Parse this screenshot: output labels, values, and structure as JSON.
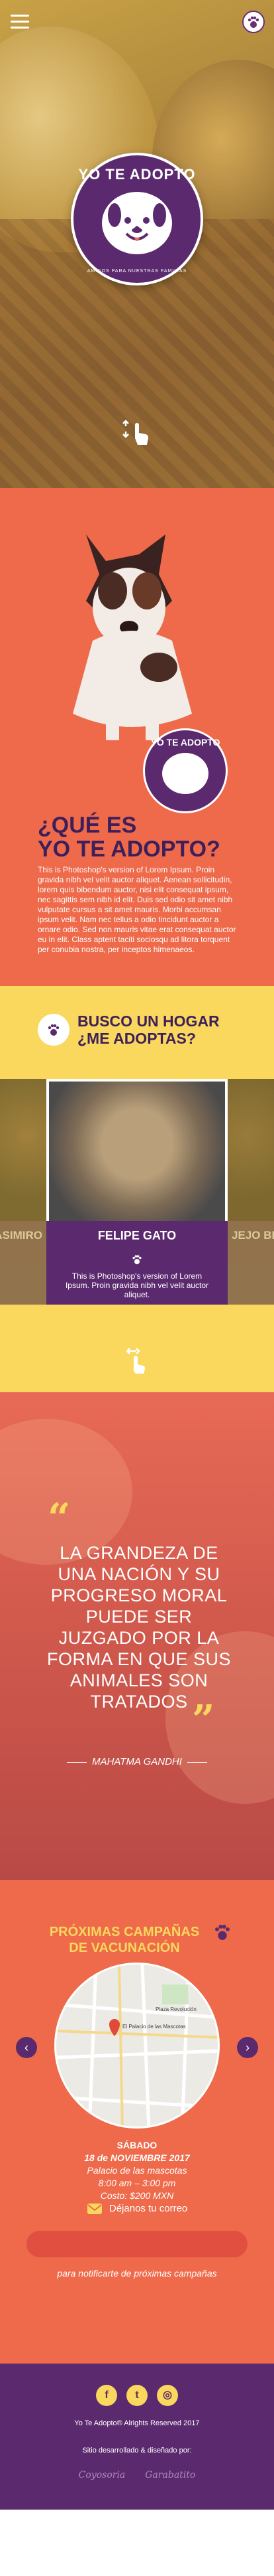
{
  "hero": {
    "logo_title": "YO TE ADOPTO",
    "logo_subtitle": "AMIGOS PARA NUESTRAS FAMILIAS"
  },
  "que_es": {
    "logo_title": "YO TE ADOPTO",
    "title_line1": "¿QUÉ ES",
    "title_line2": "YO TE ADOPTO?",
    "body": "This is Photoshop's version of Lorem Ipsum. Proin gravida nibh vel velit auctor aliquet. Aenean sollicitudin, lorem quis bibendum auctor, nisi elit consequat ipsum, nec sagittis sem nibh id elit. Duis sed odio sit amet nibh vulputate cursus a sit amet mauris. Morbi accumsan ipsum velit. Nam nec tellus a odio tincidunt auctor a ornare odio. Sed non mauris vitae erat consequat auctor eu in elit. Class aptent taciti sociosqu ad litora torquent per conubia nostra, per inceptos himenaeos."
  },
  "busco": {
    "title_line1": "BUSCO UN HOGAR",
    "title_line2": "¿ME ADOPTAS?",
    "left_name": "CASIMIRO",
    "right_name": "JEJO BEN",
    "center": {
      "name": "FELIPE GATO",
      "desc": "This is Photoshop's version of Lorem Ipsum. Proin gravida nibh vel velit auctor aliquet."
    }
  },
  "quote": {
    "text": "LA GRANDEZA DE UNA NACIÓN Y SU PROGRESO MORAL PUEDE SER JUZGADO POR LA FORMA EN QUE SUS ANIMALES SON TRATADOS",
    "author": "MAHATMA GANDHI"
  },
  "campanas": {
    "title_line1": "PRÓXIMAS CAMPAÑAS",
    "title_line2": "DE VACUNACIÓN",
    "day": "SÁBADO",
    "date": "18 de NOVIEMBRE 2017",
    "place": "Palacio de las mascotas",
    "time": "8:00 am – 3:00 pm",
    "cost": "Costo: $200 MXN",
    "mail_label": "Déjanos tu correo",
    "email_placeholder": "",
    "note": "para notificarte de próximas campañas",
    "map_labels": [
      "Plaza Revolución",
      "El Palacio de las Mascotas"
    ]
  },
  "footer": {
    "social_icons": [
      "facebook-icon",
      "twitter-icon",
      "instagram-icon"
    ],
    "rights": "Yo Te Adopto® Alrights Reserved 2017",
    "devby": "Sitio desarrollado & diseñado por:",
    "partner_logos": [
      "Coyosoria",
      "Garabatito"
    ]
  },
  "colors": {
    "purple": "#5b2a6e",
    "coral": "#ee6a4b",
    "yellow": "#f9d85d"
  }
}
